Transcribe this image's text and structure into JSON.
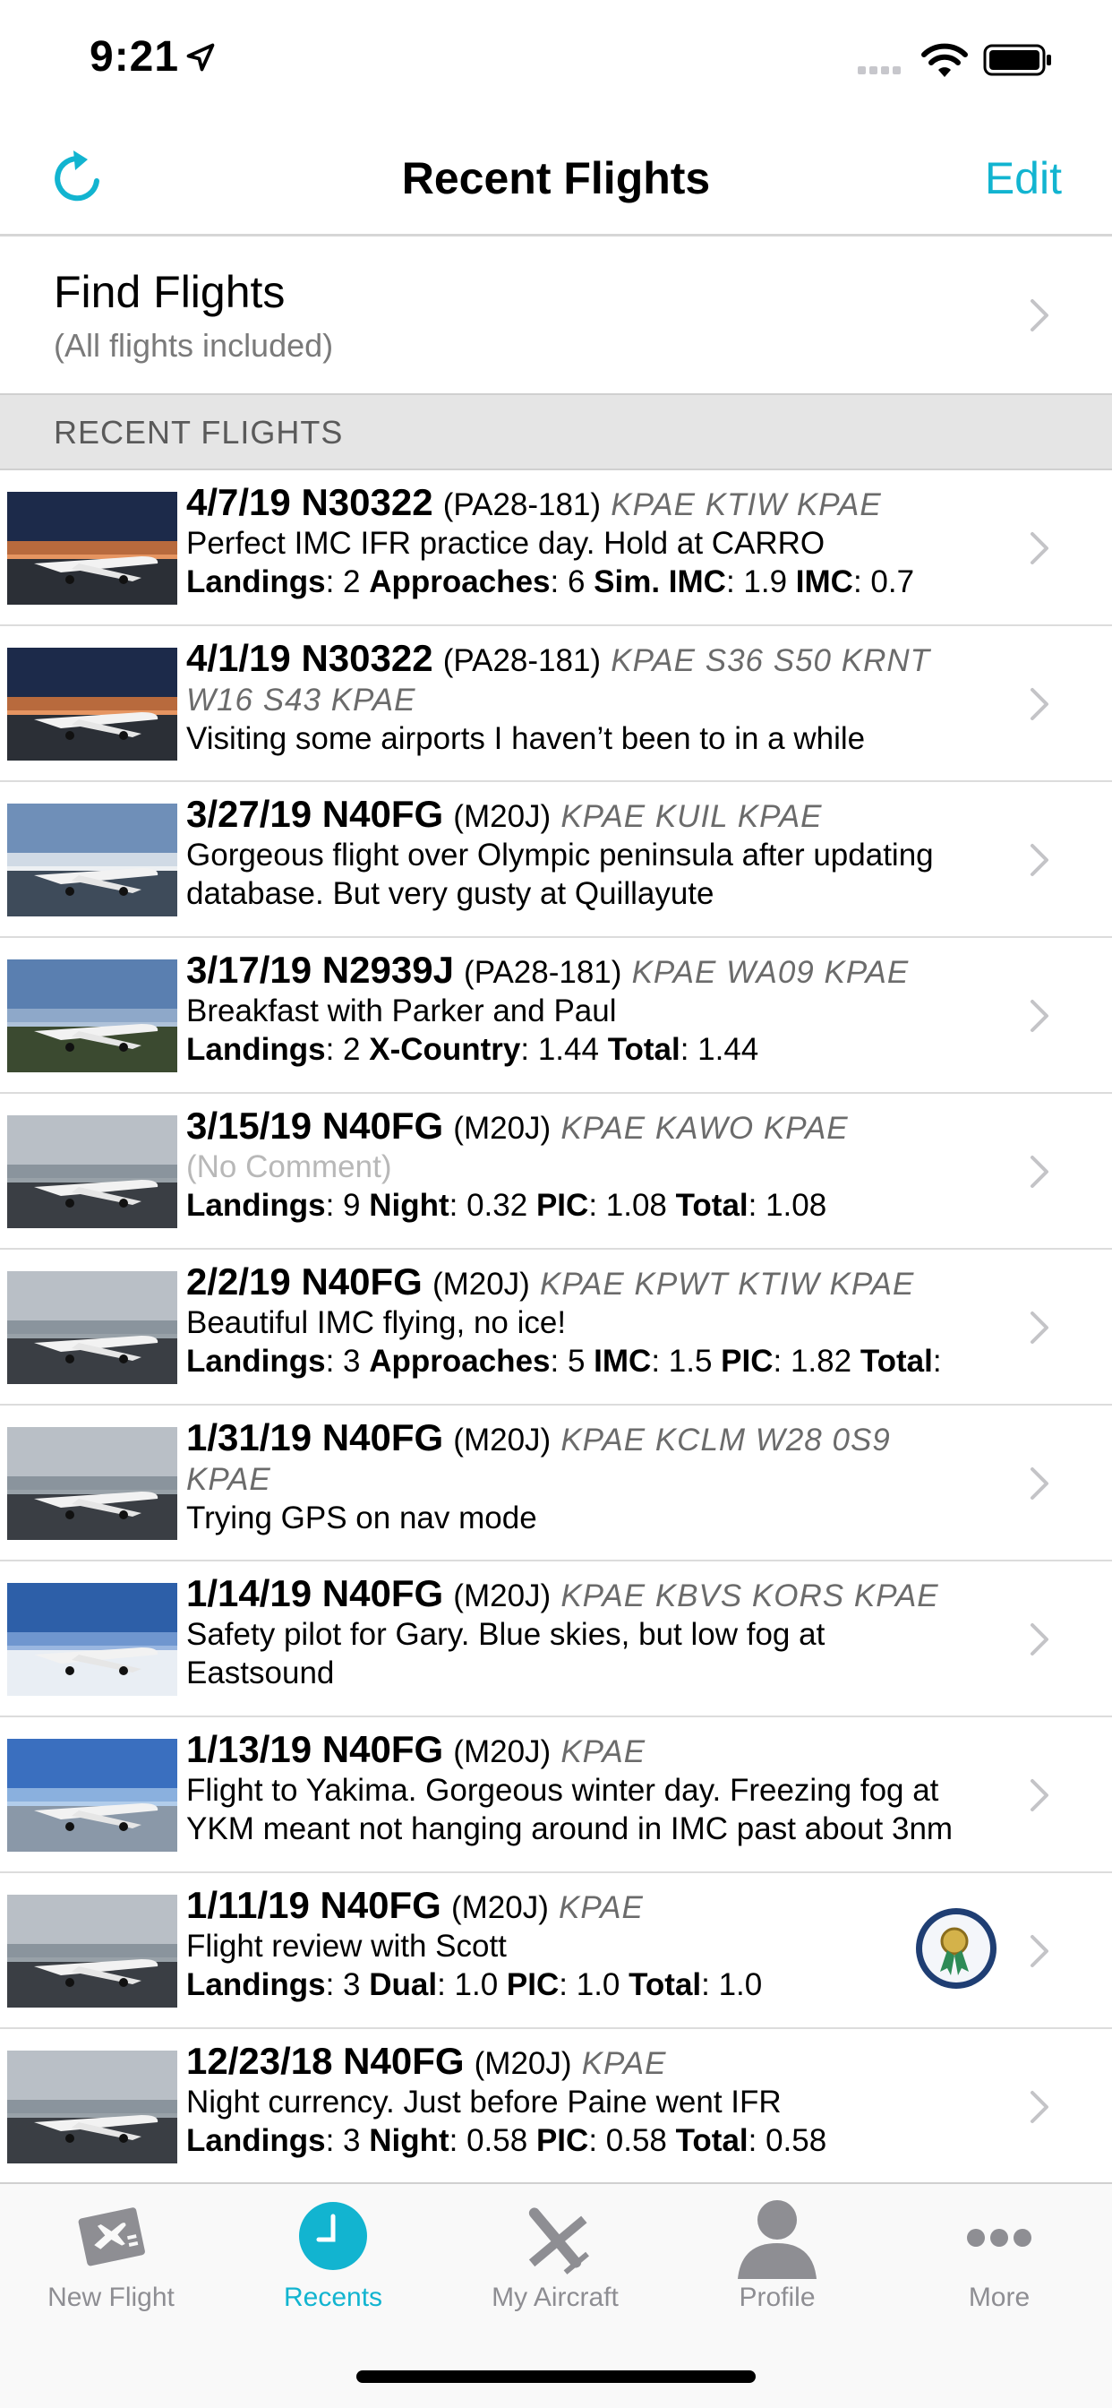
{
  "status_bar": {
    "time": "9:21"
  },
  "nav": {
    "title": "Recent Flights",
    "edit_label": "Edit"
  },
  "find": {
    "title": "Find Flights",
    "subtitle": "(All flights included)"
  },
  "section": {
    "header": "RECENT FLIGHTS"
  },
  "flights": [
    {
      "headline": "4/7/19 N30322",
      "model": "(PA28-181)",
      "route": "KPAE KTIW KPAE",
      "comment": "Perfect IMC IFR practice day. Hold at CARRO",
      "stats": [
        [
          "Landings",
          "2"
        ],
        [
          "Approaches",
          "6"
        ],
        [
          "Sim. IMC",
          "1.9"
        ],
        [
          "IMC",
          "0.7"
        ]
      ]
    },
    {
      "headline": "4/1/19 N30322",
      "model": "(PA28-181)",
      "route": "KPAE S36 S50 KRNT W16 S43 KPAE",
      "comment": "Visiting some airports I haven’t been to in a while",
      "stats": []
    },
    {
      "headline": "3/27/19 N40FG",
      "model": "(M20J)",
      "route": "KPAE KUIL KPAE",
      "comment": "Gorgeous flight over Olympic peninsula after updating database. But very gusty at Quillayute",
      "stats": []
    },
    {
      "headline": "3/17/19 N2939J",
      "model": "(PA28-181)",
      "route": "KPAE WA09 KPAE",
      "comment": "Breakfast with Parker and Paul",
      "stats": [
        [
          "Landings",
          "2"
        ],
        [
          "X-Country",
          "1.44"
        ],
        [
          "Total",
          "1.44"
        ]
      ]
    },
    {
      "headline": "3/15/19 N40FG",
      "model": "(M20J)",
      "route": "KPAE KAWO KPAE",
      "comment": "(No Comment)",
      "stats": [
        [
          "Landings",
          "9"
        ],
        [
          "Night",
          "0.32"
        ],
        [
          "PIC",
          "1.08"
        ],
        [
          "Total",
          "1.08"
        ]
      ]
    },
    {
      "headline": "2/2/19 N40FG",
      "model": "(M20J)",
      "route": "KPAE KPWT KTIW KPAE",
      "comment": "Beautiful IMC flying, no ice!",
      "stats": [
        [
          "Landings",
          "3"
        ],
        [
          "Approaches",
          "5"
        ],
        [
          "IMC",
          "1.5"
        ],
        [
          "PIC",
          "1.82"
        ],
        [
          "Total",
          ""
        ]
      ]
    },
    {
      "headline": "1/31/19 N40FG",
      "model": "(M20J)",
      "route": "KPAE KCLM W28 0S9 KPAE",
      "comment": "Trying GPS on nav mode",
      "stats": []
    },
    {
      "headline": "1/14/19 N40FG",
      "model": "(M20J)",
      "route": "KPAE KBVS KORS KPAE",
      "comment": "Safety pilot for Gary. Blue skies, but low fog at Eastsound",
      "stats": []
    },
    {
      "headline": "1/13/19 N40FG",
      "model": "(M20J)",
      "route": "KPAE",
      "comment": "Flight to Yakima. Gorgeous winter day. Freezing fog at YKM meant not hanging around in IMC past about 3nm",
      "stats": []
    },
    {
      "headline": "1/11/19 N40FG",
      "model": "(M20J)",
      "route": "KPAE",
      "comment": "Flight review with Scott",
      "stats": [
        [
          "Landings",
          "3"
        ],
        [
          "Dual",
          "1.0"
        ],
        [
          "PIC",
          "1.0"
        ],
        [
          "Total",
          "1.0"
        ]
      ]
    },
    {
      "headline": "12/23/18 N40FG",
      "model": "(M20J)",
      "route": "KPAE",
      "comment": "Night currency. Just before Paine went IFR",
      "stats": [
        [
          "Landings",
          "3"
        ],
        [
          "Night",
          "0.58"
        ],
        [
          "PIC",
          "0.58"
        ],
        [
          "Total",
          "0.58"
        ]
      ]
    }
  ],
  "tabs": [
    {
      "label": "New Flight",
      "icon": "new-flight-icon"
    },
    {
      "label": "Recents",
      "icon": "clock-icon"
    },
    {
      "label": "My Aircraft",
      "icon": "airplane-icon"
    },
    {
      "label": "Profile",
      "icon": "person-icon"
    },
    {
      "label": "More",
      "icon": "more-icon"
    }
  ],
  "colors": {
    "accent": "#12b4d0",
    "inactive": "#8e8e93"
  }
}
